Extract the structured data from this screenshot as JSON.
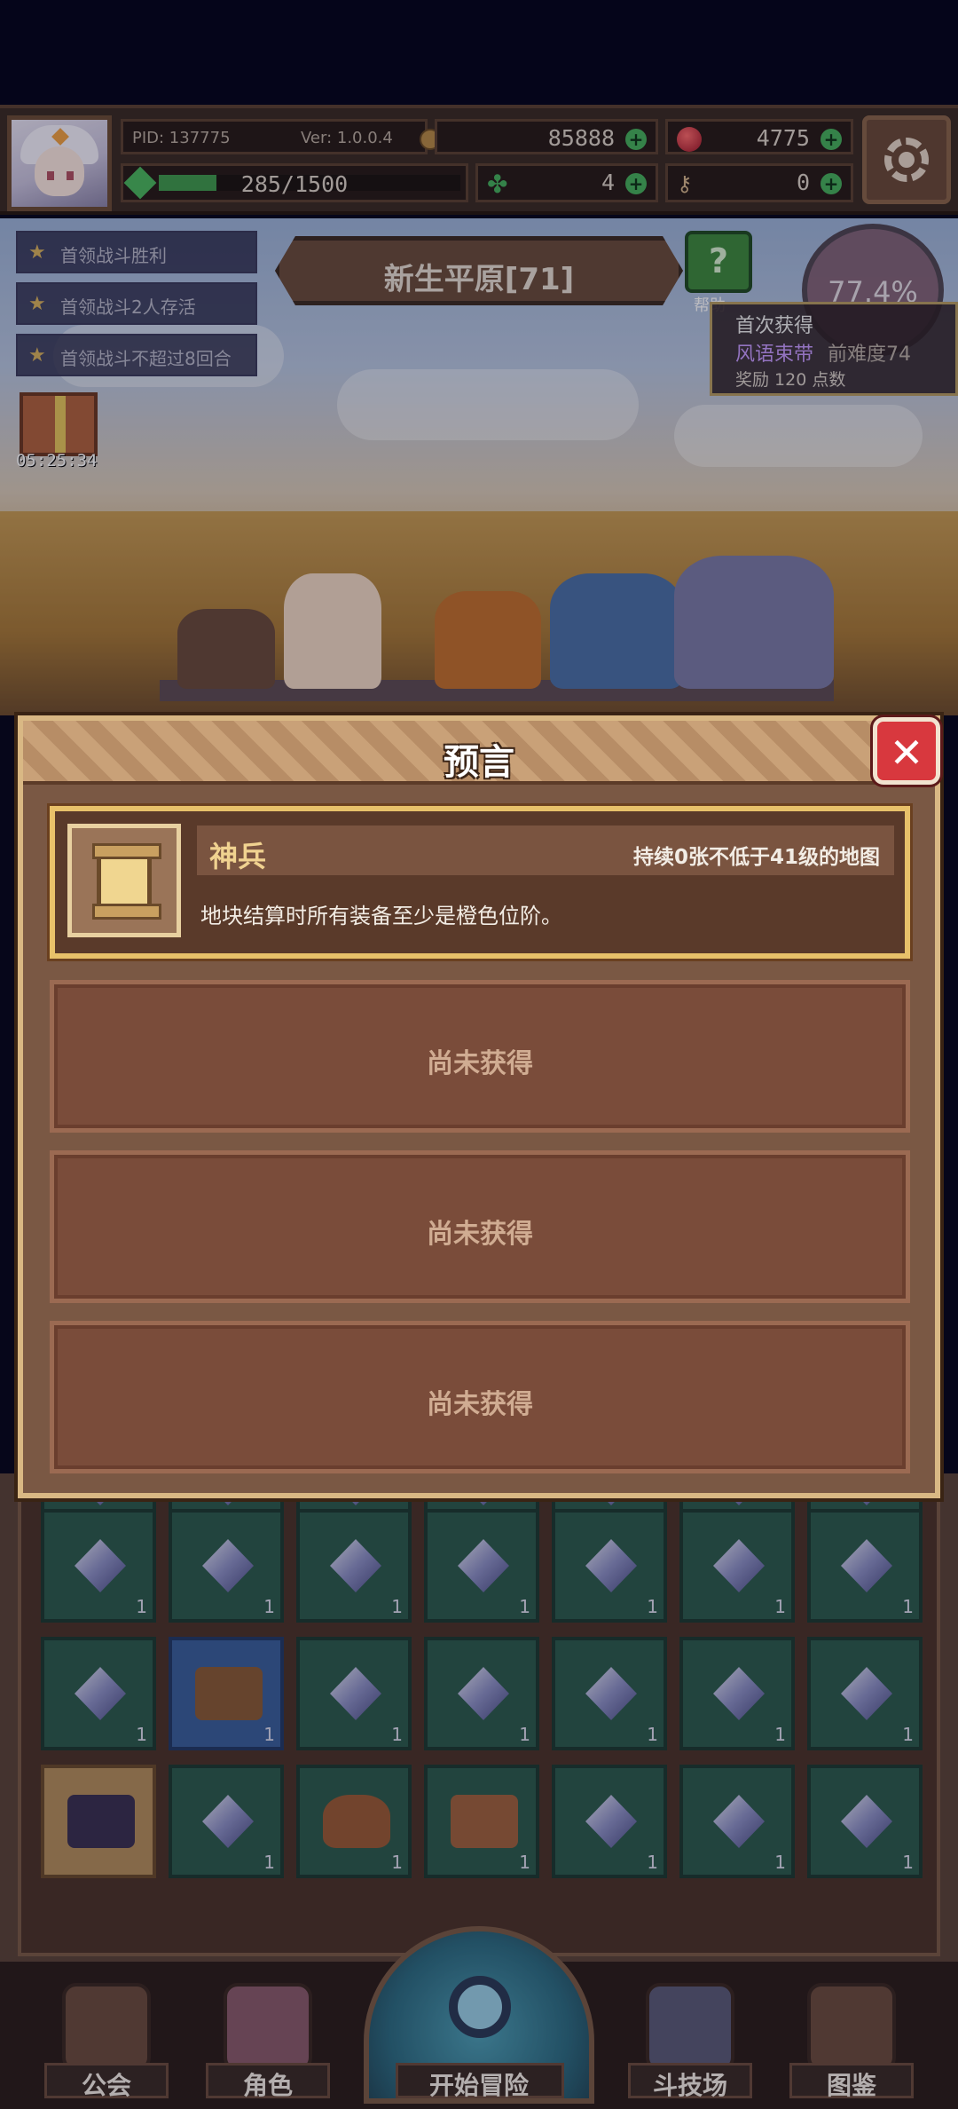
{
  "header": {
    "pid": "PID: 137775",
    "version": "Ver: 1.0.0.4",
    "gold": "85888",
    "gems": "4775",
    "xp": "285/1500",
    "xp_progress": 0.19,
    "clover": "4",
    "keys": "0"
  },
  "quests": [
    "首领战斗胜利",
    "首领战斗2人存活",
    "首领战斗不超过8回合"
  ],
  "gift_timer": "05:25:34",
  "stage": {
    "name": "新生平原[71]",
    "help_label": "帮助",
    "progress": "77.4%"
  },
  "tooltip": {
    "line1": "首次获得",
    "item": "风语束带",
    "line2_suffix": "前难度74",
    "reward": "奖励 120 点数"
  },
  "modal": {
    "title": "预言",
    "close": "✕",
    "prophecy": {
      "name": "神兵",
      "condition": "持续0张不低于41级的地图",
      "description": "地块结算时所有装备至少是橙色位阶。"
    },
    "locked_slots": [
      "尚未获得",
      "尚未获得",
      "尚未获得"
    ]
  },
  "inventory_count": "1",
  "nav": {
    "guild": "公会",
    "character": "角色",
    "adventure": "开始冒险",
    "arena": "斗技场",
    "codex": "图鉴"
  },
  "colors": {
    "accent_gold": "#e8c16a",
    "close_red": "#d8383e",
    "plus_green": "#46b05a",
    "legendary_item": "#c89cff"
  }
}
